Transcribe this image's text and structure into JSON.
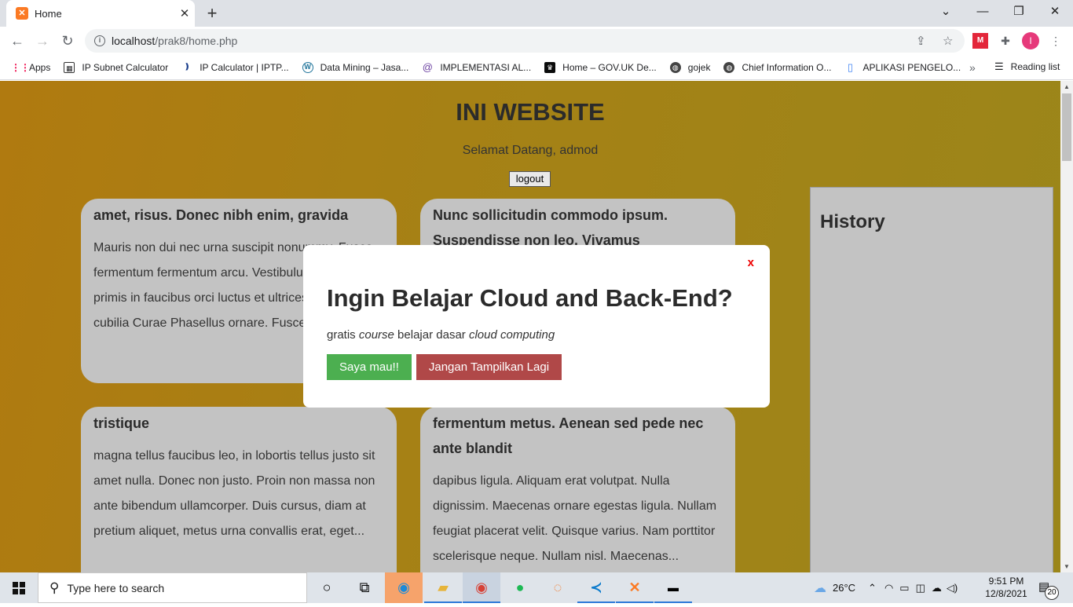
{
  "browser": {
    "tab_title": "Home",
    "tab_close": "✕",
    "new_tab": "+",
    "url_host": "localhost",
    "url_path": "/prak8/home.php",
    "profile_initial": "I",
    "bookmarks": [
      {
        "label": "Apps",
        "icon": "apps-grid-icon"
      },
      {
        "label": "IP Subnet Calculator",
        "icon": "calculator-icon"
      },
      {
        "label": "IP Calculator | IPTP...",
        "icon": "ip-icon"
      },
      {
        "label": "Data Mining – Jasa...",
        "icon": "wordpress-icon"
      },
      {
        "label": "IMPLEMENTASI AL...",
        "icon": "at-icon"
      },
      {
        "label": "Home – GOV.UK De...",
        "icon": "crown-icon"
      },
      {
        "label": "gojek",
        "icon": "globe-icon"
      },
      {
        "label": "Chief Information O...",
        "icon": "globe-icon"
      },
      {
        "label": "APLIKASI PENGELO...",
        "icon": "document-icon"
      }
    ],
    "bookmarks_more": "»",
    "reading_list": "Reading list"
  },
  "page": {
    "title": "INI WEBSITE",
    "welcome": "Selamat Datang, admod",
    "logout": "logout",
    "cards": [
      {
        "title": "amet, risus. Donec nibh enim, gravida",
        "body": "Mauris non dui nec urna suscipit nonummy. Fusce fermentum fermentum arcu. Vestibulum ante ipsum primis in faucibus orci luctus et ultrices posuere cubilia Curae Phasellus ornare. Fusce..."
      },
      {
        "title": "Nunc sollicitudin commodo ipsum. Suspendisse non leo. Vivamus",
        "body": ""
      },
      {
        "title": "tristique",
        "body": "magna tellus faucibus leo, in lobortis tellus justo sit amet nulla. Donec non justo. Proin non massa non ante bibendum ullamcorper. Duis cursus, diam at pretium aliquet, metus urna convallis erat, eget..."
      },
      {
        "title": "fermentum metus. Aenean sed pede nec ante blandit",
        "body": "dapibus ligula. Aliquam erat volutpat. Nulla dignissim. Maecenas ornare egestas ligula. Nullam feugiat placerat velit. Quisque varius. Nam porttitor scelerisque neque. Nullam nisl. Maecenas..."
      }
    ],
    "history_title": "History"
  },
  "modal": {
    "close": "x",
    "title": "Ingin Belajar Cloud and Back-End?",
    "text_1": "gratis ",
    "text_em1": "course",
    "text_2": " belajar dasar ",
    "text_em2": "cloud computing",
    "yes": "Saya mau!!",
    "no": "Jangan Tampilkan Lagi"
  },
  "taskbar": {
    "search_placeholder": "Type here to search",
    "weather": "26°C",
    "time": "9:51 PM",
    "date": "12/8/2021",
    "notifications": "20"
  },
  "colors": {
    "modal_yes": "#4caf50",
    "modal_no": "#b04848",
    "page_background": "#a68115"
  }
}
